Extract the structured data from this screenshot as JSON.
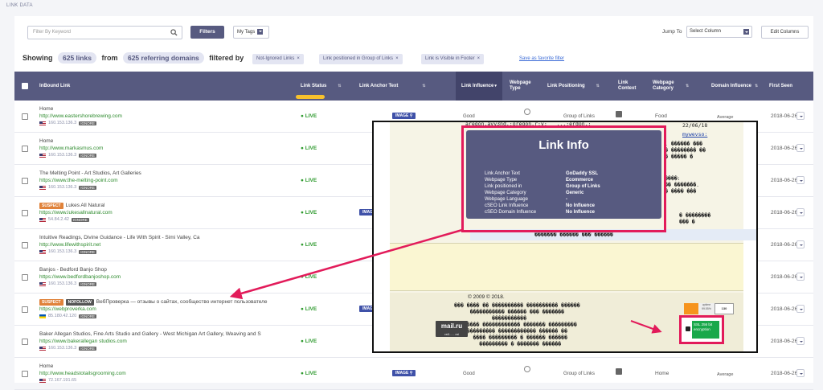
{
  "section_label": "LINK DATA",
  "toolbar": {
    "search_placeholder": "Filter By Keyword",
    "filters_label": "Filters",
    "tags_label": "My Tags",
    "jump_label": "Jump To",
    "jump_value": "Select Column",
    "edit_columns_label": "Edit Columns"
  },
  "summary": {
    "showing": "Showing",
    "links_count": "625 links",
    "from": "from",
    "domains_count": "625 referring domains",
    "filtered_by": "filtered by",
    "filters": [
      "Not-Ignored Links",
      "Link positioned in Group of Links",
      "Link is Visible in Footer"
    ],
    "save_favorite": "Save as favorite filter"
  },
  "columns": {
    "inbound": "InBound Link",
    "status": "Link Status",
    "anchor": "Link Anchor Text",
    "influence": "Link Influence",
    "webpage_type": "Webpage Type",
    "positioning": "Link Positioning",
    "context": "Link Context",
    "category": "Webpage Category",
    "domain_influence": "Domain Influence",
    "first_seen": "First Seen"
  },
  "rows": [
    {
      "title": "Home",
      "url": "http://www.eastershorebrewing.com",
      "ip": "160.153.136.3",
      "ignore": "IGNORE",
      "status": "LIVE",
      "anchor_badge": "IMAGE",
      "influence": "Good",
      "positioning": "Group of Links",
      "category": "Food",
      "domain_influence": "Average",
      "date": "2018-06-26"
    },
    {
      "title": "Home",
      "url": "http://www.markasmus.com",
      "ip": "160.153.136.3",
      "ignore": "IGNORE",
      "status": "LIVE",
      "date": "2018-06-26"
    },
    {
      "title": "The Melting Point - Art Studios, Art Galleries",
      "url": "https://www.the-melting-point.com",
      "ip": "160.153.136.3",
      "ignore": "IGNORE",
      "status": "LIVE",
      "date": "2018-06-26"
    },
    {
      "suspect": "SUSPECT",
      "title": "Lukes All Natural",
      "url": "https://www.lukesallnatural.com",
      "ip": "54.84.2.42",
      "ignore": "IGNORE",
      "status": "LIVE",
      "anchor_badge": "IMAGE",
      "date": "2018-06-26"
    },
    {
      "title": "Intuitive Readings, Divine Guidance - Life With Spirit - Simi Valley, Ca",
      "url": "http://www.lifewithspirit.net",
      "ip": "160.153.136.3",
      "ignore": "IGNORE",
      "status": "LIVE",
      "date": "2018-06-26"
    },
    {
      "title": "Banjos - Bedford Banjo Shop",
      "url": "https://www.bedfordbanjoshop.com",
      "ip": "160.153.136.3",
      "ignore": "IGNORE",
      "status": "LIVE",
      "date": "2018-06-26"
    },
    {
      "suspect": "SUSPECT",
      "nofollow": "NOFOLLOW",
      "title": "ВебПроверка — отзывы о сайтах, сообщество интернет пользователе",
      "url": "https://webproverka.com",
      "ip": "85.180.42.120",
      "ignore": "IGNORE",
      "status": "LIVE",
      "anchor_badge": "IMAGE",
      "date": "2018-06-26"
    },
    {
      "title": "Baker Allegan Studios, Fine Arts Studio and Gallery - West Michigan Art Gallery, Weaving and S",
      "url": "https://www.bakerallegan studios.com",
      "ip": "160.153.136.3",
      "ignore": "IGNORE",
      "status": "LIVE",
      "date": "2018-06-26"
    },
    {
      "title": "Home",
      "url": "http://www.headstotailsgrooming.com",
      "ip": "72.167.191.65",
      "ignore": "IGNORE",
      "status": "LIVE",
      "anchor_badge": "IMAGE",
      "influence": "Good",
      "positioning": "Group of Links",
      "category": "Home",
      "domain_influence": "Average",
      "date": "2018-06-26"
    }
  ],
  "overlay": {
    "date_text": "22/06/18",
    "title": "Link Info",
    "fields": [
      {
        "k": "Link Anchor Text",
        "v": "GoDaddy SSL"
      },
      {
        "k": "Webpage Type",
        "v": "Ecommerce"
      },
      {
        "k": "Link positioned in",
        "v": "Group of Links"
      },
      {
        "k": "Webpage Category",
        "v": "Generic"
      },
      {
        "k": "Webpage Language",
        "v": "-"
      },
      {
        "k": "cSEO Link Influence",
        "v": "No Influence"
      },
      {
        "k": "cSEO Domain Influence",
        "v": "No Influence"
      }
    ],
    "copyright": "© 2009 © 2018.",
    "mailru": "mail.ru",
    "ssl_text": "SSL 256 bit encryption",
    "widget_number": "130"
  }
}
